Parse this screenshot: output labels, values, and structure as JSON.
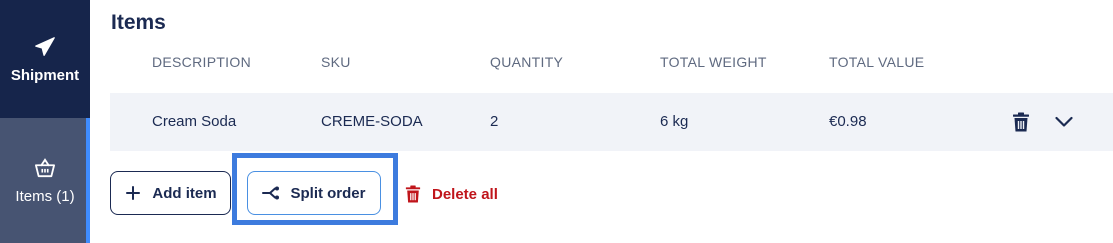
{
  "sidebar": {
    "items": [
      {
        "label": "Shipment",
        "icon": "paper-plane-icon"
      },
      {
        "label": "Items (1)",
        "icon": "basket-icon"
      }
    ]
  },
  "section": {
    "title": "Items"
  },
  "table": {
    "columns": [
      "DESCRIPTION",
      "SKU",
      "QUANTITY",
      "TOTAL WEIGHT",
      "TOTAL VALUE"
    ],
    "rows": [
      {
        "description": "Cream Soda",
        "sku": "CREME-SODA",
        "quantity": "2",
        "total_weight": "6 kg",
        "total_value": "€0.98"
      }
    ]
  },
  "actions": {
    "add_item": "Add item",
    "split_order": "Split order",
    "delete_all": "Delete all"
  },
  "colors": {
    "sidebar_bg": "#1b2a52",
    "active_accent": "#3f8cff",
    "text_primary": "#1b2a52",
    "danger": "#c0151b"
  }
}
